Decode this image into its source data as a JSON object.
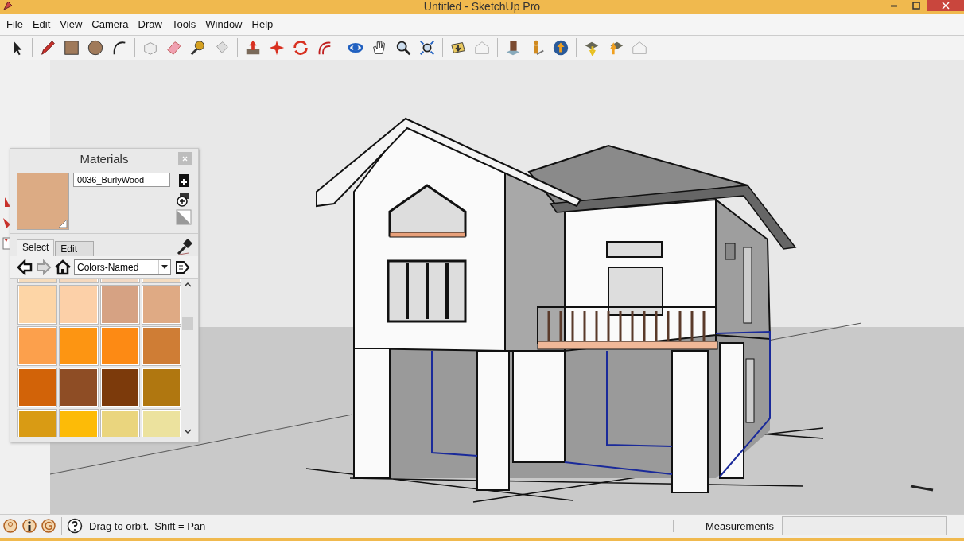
{
  "window": {
    "title": "Untitled - SketchUp Pro"
  },
  "menu": [
    "File",
    "Edit",
    "View",
    "Camera",
    "Draw",
    "Tools",
    "Window",
    "Help"
  ],
  "materials_panel": {
    "title": "Materials",
    "material_name": "0036_BurlyWood",
    "tabs": [
      {
        "label": "Select",
        "selected": true
      },
      {
        "label": "Edit",
        "selected": false
      }
    ],
    "library": "Colors-Named",
    "swatches": [
      {
        "color": "#f6dcbc"
      },
      {
        "color": "#f5d8bd"
      },
      {
        "color": "#f2d9c4"
      },
      {
        "color": "#f4dcc0"
      },
      {
        "color": "#fdd5a6"
      },
      {
        "color": "#fcd0a8"
      },
      {
        "color": "#d6a283"
      },
      {
        "color": "#dfaa84"
      },
      {
        "color": "#fca04c"
      },
      {
        "color": "#fd9512"
      },
      {
        "color": "#fd8a14"
      },
      {
        "color": "#cf7d35"
      },
      {
        "color": "#d26308"
      },
      {
        "color": "#8e4d25"
      },
      {
        "color": "#7c3a0b"
      },
      {
        "color": "#b07710"
      },
      {
        "color": "#d99b14"
      },
      {
        "color": "#fdbb07"
      },
      {
        "color": "#ead57e"
      },
      {
        "color": "#ece29e"
      }
    ]
  },
  "status_bar": {
    "hint": "Drag to orbit.  Shift = Pan",
    "measurements_label": "Measurements"
  }
}
